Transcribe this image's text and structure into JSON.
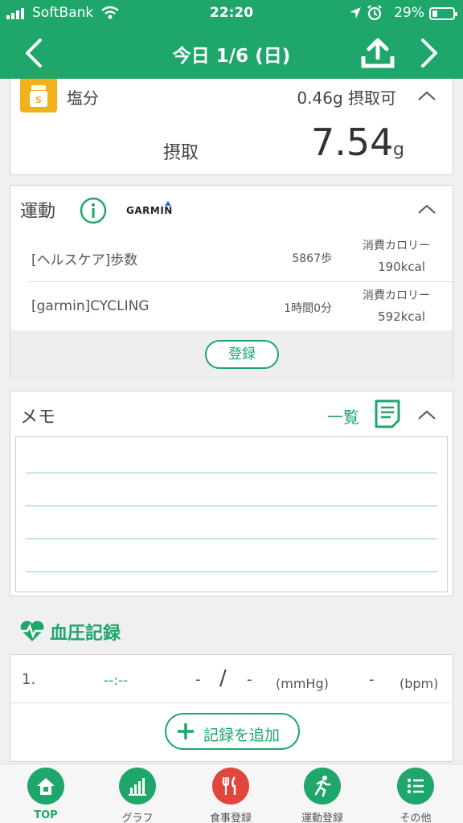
{
  "colors": {
    "brand": "#1ea66b",
    "salt": "#f2b11a",
    "meal": "#e2453b"
  },
  "status": {
    "carrier": "SoftBank",
    "time": "22:20",
    "battery": "29%"
  },
  "header": {
    "title": "今日 1/6 (日)"
  },
  "salt": {
    "label": "塩分",
    "available": "0.46g 摂取可",
    "intake_label": "摂取",
    "intake_value": "7.54",
    "intake_unit": "g"
  },
  "exercise": {
    "title": "運動",
    "brand": "GARMIN",
    "rows": [
      {
        "name": "[ヘルスケア]歩数",
        "quantity": "5867歩",
        "cal_label": "消費カロリー",
        "calories": "190kcal"
      },
      {
        "name": "[garmin]CYCLING",
        "quantity": "1時間0分",
        "cal_label": "消費カロリー",
        "calories": "592kcal"
      }
    ],
    "register_label": "登録"
  },
  "memo": {
    "title": "メモ",
    "list_label": "一覧"
  },
  "blood_pressure": {
    "title": "血圧記録",
    "row": {
      "index": "1.",
      "time": "--:--",
      "systolic": "-",
      "slash": "/",
      "diastolic": "-",
      "unit_pressure": "(mmHg)",
      "pulse": "-",
      "unit_pulse": "(bpm)"
    },
    "add_label": "記録を追加"
  },
  "tabs": [
    {
      "label": "TOP",
      "icon": "home-icon"
    },
    {
      "label": "グラフ",
      "icon": "chart-icon"
    },
    {
      "label": "食事登録",
      "icon": "fork-knife-icon"
    },
    {
      "label": "運動登録",
      "icon": "runner-icon"
    },
    {
      "label": "その他",
      "icon": "list-icon"
    }
  ]
}
